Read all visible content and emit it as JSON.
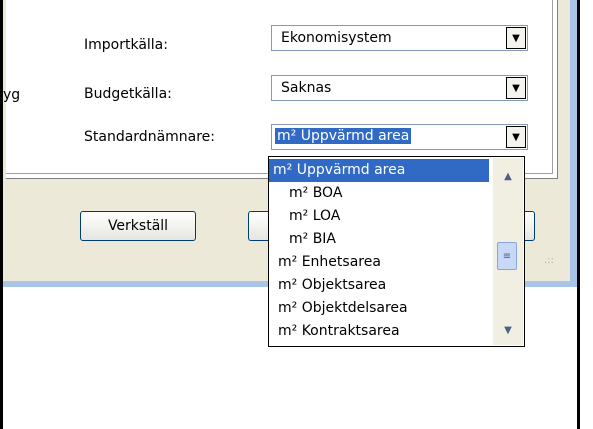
{
  "form": {
    "partial_left_text": "yg",
    "import_label": "Importkälla:",
    "import_value": "Ekonomisystem",
    "budget_label": "Budgetkälla:",
    "budget_value": "Saknas",
    "denominator_label": "Standardnämnare:",
    "denominator_value": "m² Uppvärmd area"
  },
  "buttons": {
    "apply_label": "Verkställ"
  },
  "dropdown": {
    "items": [
      "m² Uppvärmd area",
      "m² BOA",
      "m² LOA",
      "m² BIA",
      "m² Enhetsarea",
      "m² Objektsarea",
      "m² Objektdelsarea",
      "m² Kontraktsarea"
    ],
    "selected_index": 0
  },
  "icons": {
    "combo_arrow": "chevron-down-icon",
    "scroll_up": "arrow-up-icon",
    "scroll_down": "arrow-down-icon",
    "scroll_thumb": "grip-lines-icon",
    "resize_grip": "resize-grip-icon"
  },
  "colors": {
    "selection": "#316ac5",
    "dialog_bg": "#ece9d8",
    "window_border_blue": "#a8c4e8"
  }
}
